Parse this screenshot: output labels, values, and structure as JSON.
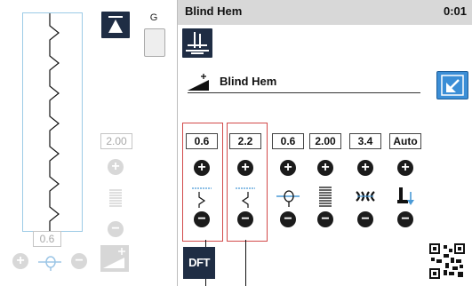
{
  "header": {
    "title": "Blind Hem",
    "time": "0:01"
  },
  "pattern": {
    "name": "Blind Hem"
  },
  "foot": {
    "letter": "G"
  },
  "left": {
    "density_value": "2.00",
    "length_value": "0.6"
  },
  "params": [
    {
      "value": "0.6",
      "icon": "width-icon",
      "highlighted": true
    },
    {
      "value": "2.2",
      "icon": "position-icon",
      "highlighted": true
    },
    {
      "value": "0.6",
      "icon": "stitch-length-icon",
      "highlighted": false
    },
    {
      "value": "2.00",
      "icon": "density-icon",
      "highlighted": false
    },
    {
      "value": "3.4",
      "icon": "thread-tension-icon",
      "highlighted": false
    },
    {
      "value": "Auto",
      "icon": "presser-foot-pressure-icon",
      "highlighted": false
    }
  ],
  "buttons": {
    "dft_label": "DFT"
  },
  "colors": {
    "dark": "#1f2d44",
    "accent": "#3b8ed6",
    "header": "#d8d8d8",
    "highlight": "#d24a4a"
  }
}
